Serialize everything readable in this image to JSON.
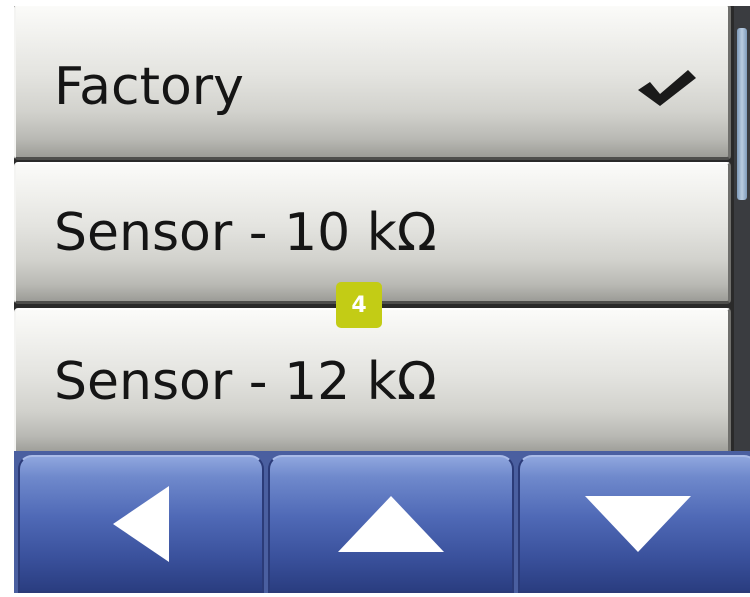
{
  "menu": {
    "items": [
      {
        "label": "Factory",
        "selected": true,
        "selected_icon": "check-icon"
      },
      {
        "label": "Sensor - 10 kΩ",
        "selected": false
      },
      {
        "label": "Sensor - 12 kΩ",
        "selected": false
      }
    ]
  },
  "callout": {
    "number": "4",
    "color": "#c3cc15"
  },
  "nav": {
    "buttons": [
      {
        "icon": "arrow-left-icon"
      },
      {
        "icon": "arrow-up-icon"
      },
      {
        "icon": "arrow-down-icon"
      }
    ],
    "button_color": "#4f69b6"
  },
  "scrollbar": {
    "thumb_color": "#9fb4cf"
  }
}
